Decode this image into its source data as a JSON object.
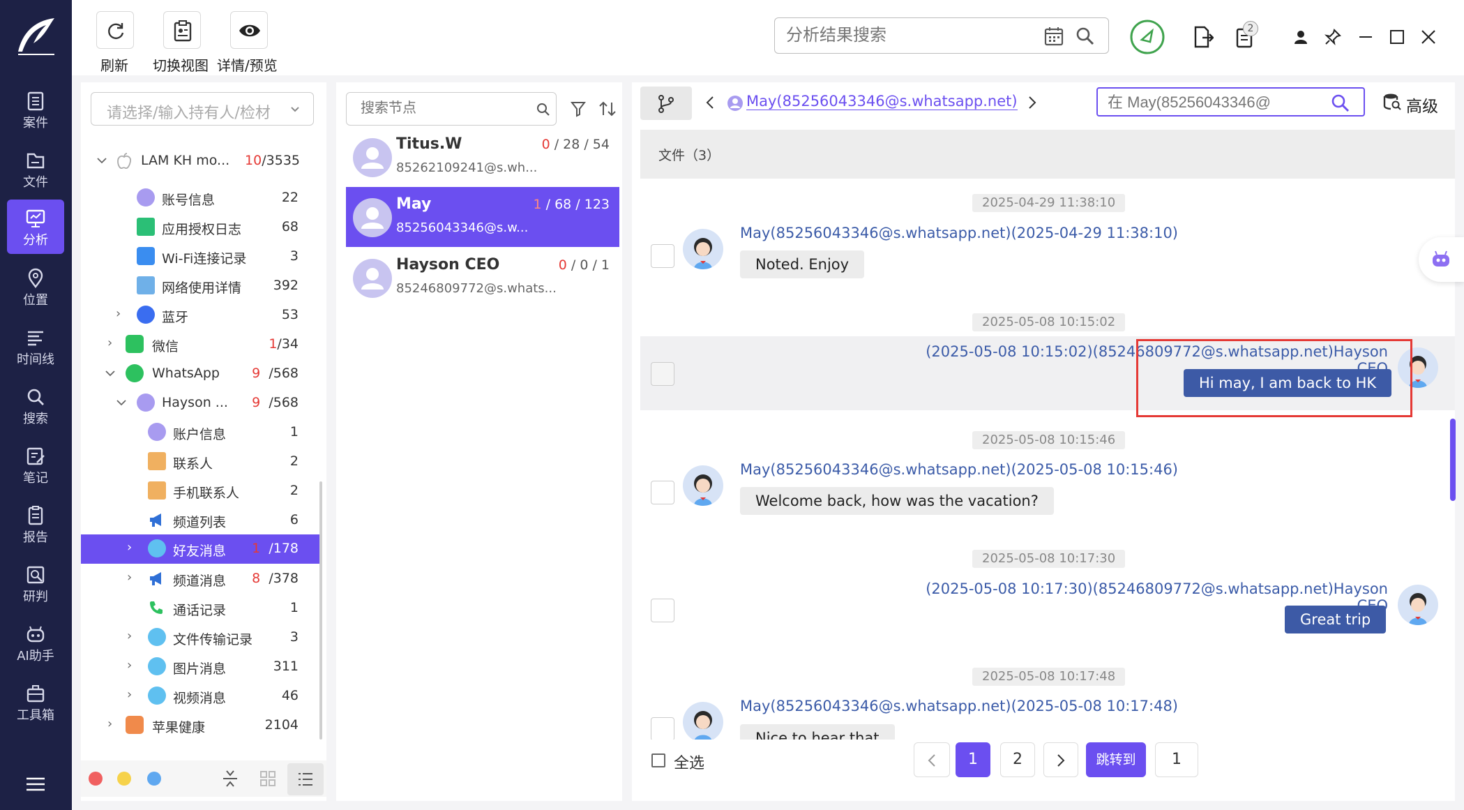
{
  "toolbar": {
    "refresh": "刷新",
    "switch_view": "切换视图",
    "detail_preview": "详情/预览",
    "search_placeholder": "分析结果搜索",
    "badge_count": "2"
  },
  "nav": [
    {
      "label": "案件",
      "icon": "case-icon"
    },
    {
      "label": "文件",
      "icon": "folder-icon"
    },
    {
      "label": "分析",
      "icon": "analysis-icon"
    },
    {
      "label": "位置",
      "icon": "location-icon"
    },
    {
      "label": "时间线",
      "icon": "timeline-icon"
    },
    {
      "label": "搜索",
      "icon": "search-icon"
    },
    {
      "label": "笔记",
      "icon": "note-icon"
    },
    {
      "label": "报告",
      "icon": "report-icon"
    },
    {
      "label": "研判",
      "icon": "judge-icon"
    },
    {
      "label": "AI助手",
      "icon": "robot-icon"
    },
    {
      "label": "工具箱",
      "icon": "toolbox-icon"
    }
  ],
  "tree": {
    "owner_placeholder": "请选择/输入持有人/检材",
    "root": {
      "label": "LAM KH mo...",
      "red": "10",
      "total": "/3535"
    },
    "items": [
      {
        "label": "账号信息",
        "count": "22"
      },
      {
        "label": "应用授权日志",
        "count": "68"
      },
      {
        "label": "Wi-Fi连接记录",
        "count": "3"
      },
      {
        "label": "网络使用详情",
        "count": "392"
      },
      {
        "label": "蓝牙",
        "count": "53"
      },
      {
        "label": "微信",
        "red": "1",
        "count": "/34"
      },
      {
        "label": "WhatsApp",
        "red": "9",
        "count": "/568"
      },
      {
        "label": "Hayson ...",
        "red": "9",
        "count": "/568"
      },
      {
        "label": "账户信息",
        "count": "1"
      },
      {
        "label": "联系人",
        "count": "2"
      },
      {
        "label": "手机联系人",
        "count": "2"
      },
      {
        "label": "频道列表",
        "count": "6"
      },
      {
        "label": "好友消息",
        "red": "1",
        "count": "/178"
      },
      {
        "label": "频道消息",
        "red": "8",
        "count": "/378"
      },
      {
        "label": "通话记录",
        "count": "1"
      },
      {
        "label": "文件传输记录",
        "count": "3"
      },
      {
        "label": "图片消息",
        "count": "311"
      },
      {
        "label": "视频消息",
        "count": "46"
      },
      {
        "label": "苹果健康",
        "count": "2104"
      }
    ]
  },
  "nodes": {
    "search_placeholder": "搜索节点",
    "contacts": [
      {
        "name": "Titus.W",
        "id": "85262109241@s.wh...",
        "red": "0",
        "counts": " / 28 / 54"
      },
      {
        "name": "May",
        "id": "85256043346@s.w...",
        "red": "1",
        "counts": " / 68 / 123"
      },
      {
        "name": "Hayson CEO",
        "id": "85246809772@s.whats...",
        "red": "0",
        "counts": " / 0 / 1"
      }
    ]
  },
  "chat": {
    "header_contact": "May(85256043346@s.whatsapp.net)",
    "search_placeholder": "在 May(85256043346@",
    "advanced": "高级",
    "files_label": "文件（3）",
    "messages": [
      {
        "ts": "2025-04-29 11:38:10",
        "sender": "May(85256043346@s.whatsapp.net)(2025-04-29 11:38:10)",
        "text": "Noted.  Enjoy"
      },
      {
        "ts": "2025-05-08 10:15:02",
        "sender": "(2025-05-08 10:15:02)(85246809772@s.whatsapp.net)Hayson CEO",
        "text": "Hi may, I am back to HK"
      },
      {
        "ts": "2025-05-08 10:15:46",
        "sender": "May(85256043346@s.whatsapp.net)(2025-05-08 10:15:46)",
        "text": "Welcome back, how was the vacation?"
      },
      {
        "ts": "2025-05-08 10:17:30",
        "sender": "(2025-05-08 10:17:30)(85246809772@s.whatsapp.net)Hayson CEO",
        "text": "Great trip"
      },
      {
        "ts": "2025-05-08 10:17:48",
        "sender": "May(85256043346@s.whatsapp.net)(2025-05-08 10:17:48)",
        "text": "Nice to hear that"
      }
    ],
    "select_all": "全选",
    "pages": [
      "1",
      "2"
    ],
    "jump_to": "跳转到",
    "jump_value": "1"
  },
  "colors": {
    "accent": "#6b4ff0",
    "nav_bg": "#1d2145",
    "bubble_out": "#3d5aa6",
    "highlight": "#e53935"
  }
}
